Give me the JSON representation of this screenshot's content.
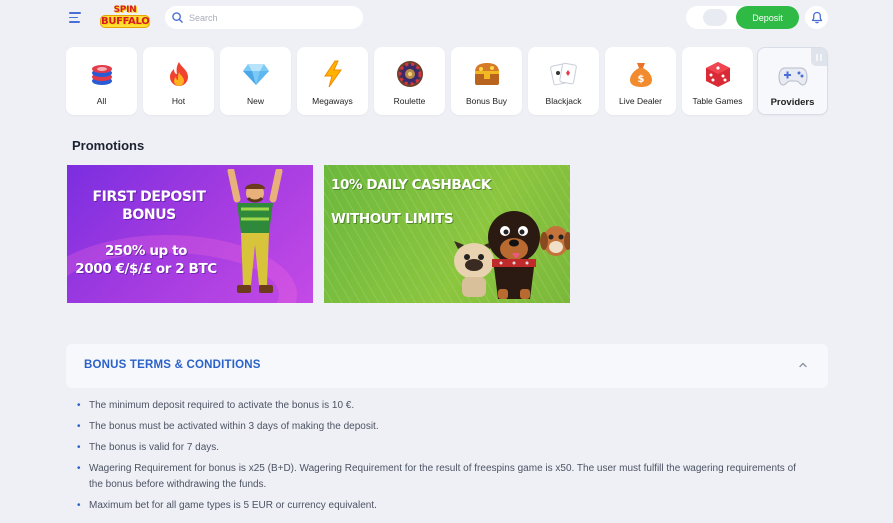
{
  "header": {
    "logo": {
      "line1": "SPIN",
      "line2": "BUFFALO"
    },
    "search_placeholder": "Search",
    "deposit_label": "Deposit"
  },
  "categories": [
    {
      "label": "All",
      "icon": "chips-icon"
    },
    {
      "label": "Hot",
      "icon": "fire-icon"
    },
    {
      "label": "New",
      "icon": "diamond-icon"
    },
    {
      "label": "Megaways",
      "icon": "lightning-icon"
    },
    {
      "label": "Roulette",
      "icon": "roulette-icon"
    },
    {
      "label": "Bonus Buy",
      "icon": "treasure-chest-icon"
    },
    {
      "label": "Blackjack",
      "icon": "cards-icon"
    },
    {
      "label": "Live Dealer",
      "icon": "money-bag-icon"
    },
    {
      "label": "Table Games",
      "icon": "dice-icon"
    },
    {
      "label": "Providers",
      "icon": "gamepad-icon"
    }
  ],
  "promotions": {
    "title": "Promotions",
    "banners": [
      {
        "line1": "FIRST DEPOSIT",
        "line2": "BONUS",
        "line3": "250% up to",
        "line4": "2000 €/$/£ or 2 BTC"
      },
      {
        "line1": "10% DAILY CASHBACK",
        "line2": "WITHOUT LIMITS"
      }
    ]
  },
  "terms": {
    "title": "BONUS TERMS & CONDITIONS",
    "items": [
      "The minimum deposit required to activate the bonus is 10 €.",
      "The bonus must be activated within 3 days of making the deposit.",
      "The bonus is valid for 7 days.",
      "Wagering Requirement for bonus is x25 (B+D). Wagering Requirement for the result of freespins game is x50. The user must fulfill the wagering requirements of the bonus before withdrawing the funds.",
      "Maximum bet for all game types is 5 EUR or currency equivalent."
    ]
  },
  "colors": {
    "accent": "#2a62c9",
    "deposit": "#2fba45",
    "background": "#eef0f6"
  }
}
